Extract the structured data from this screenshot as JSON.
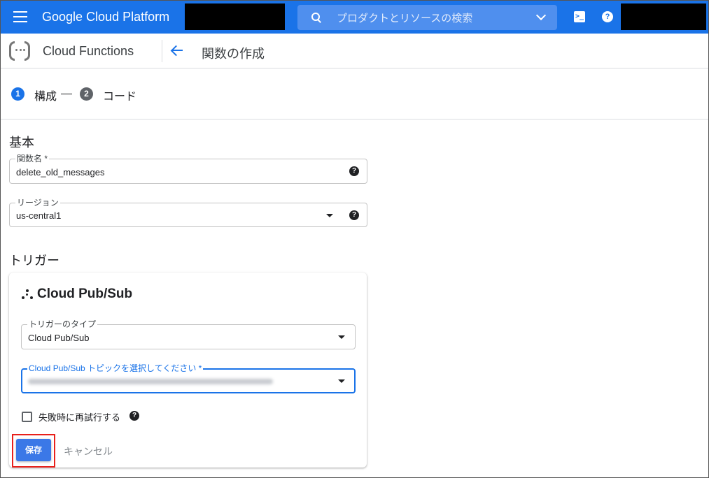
{
  "topbar": {
    "brand": "Google Cloud Platform",
    "search_placeholder": "プロダクトとリソースの検索",
    "cloudshell_glyph": ">_",
    "help_glyph": "?"
  },
  "subheader": {
    "product": "Cloud Functions",
    "page_title": "関数の作成"
  },
  "stepper": {
    "steps": [
      {
        "number": "1",
        "label": "構成"
      },
      {
        "number": "2",
        "label": "コード"
      }
    ]
  },
  "basic": {
    "section_title": "基本",
    "function_name": {
      "label": "関数名 *",
      "value": "delete_old_messages"
    },
    "region": {
      "label": "リージョン",
      "value": "us-central1"
    }
  },
  "trigger": {
    "section_title": "トリガー",
    "card_title": "Cloud Pub/Sub",
    "trigger_type": {
      "label": "トリガーのタイプ",
      "value": "Cloud Pub/Sub"
    },
    "topic": {
      "label": "Cloud Pub/Sub トピックを選択してください *"
    },
    "retry_label": "失敗時に再試行する",
    "save_label": "保存",
    "cancel_label": "キャンセル"
  },
  "colors": {
    "primary": "#1a73e8",
    "highlight_box": "#e8201b"
  }
}
